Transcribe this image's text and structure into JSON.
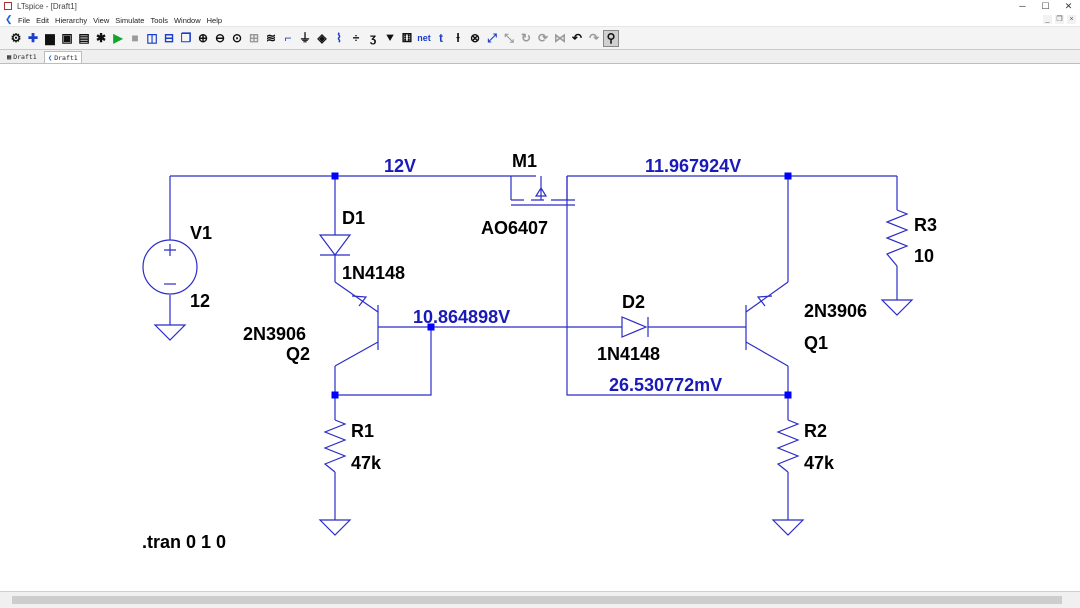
{
  "window": {
    "title": "LTspice - [Draft1]",
    "controls": [
      "─",
      "☐",
      "✕"
    ]
  },
  "menu": {
    "items": [
      "File",
      "Edit",
      "Hierarchy",
      "View",
      "Simulate",
      "Tools",
      "Window",
      "Help"
    ],
    "mdi_controls": [
      "_",
      "❐",
      "×"
    ]
  },
  "toolbar": {
    "icons": [
      {
        "name": "settings-icon",
        "glyph": "⚙",
        "style": ""
      },
      {
        "name": "open-icon",
        "glyph": "✚",
        "style": "blue"
      },
      {
        "name": "open-folder-icon",
        "glyph": "▆",
        "style": ""
      },
      {
        "name": "save-icon",
        "glyph": "▣",
        "style": ""
      },
      {
        "name": "print-icon",
        "glyph": "▤",
        "style": ""
      },
      {
        "name": "chip-icon",
        "glyph": "✱",
        "style": ""
      },
      {
        "name": "run-icon",
        "glyph": "▶",
        "style": "green"
      },
      {
        "name": "halt-icon",
        "glyph": "■",
        "style": "gray"
      },
      {
        "name": "tile-vertical-icon",
        "glyph": "◫",
        "style": "blue"
      },
      {
        "name": "tile-horizontal-icon",
        "glyph": "⊟",
        "style": "blue"
      },
      {
        "name": "cascade-icon",
        "glyph": "❐",
        "style": "blue"
      },
      {
        "name": "zoom-in-icon",
        "glyph": "⊕",
        "style": ""
      },
      {
        "name": "zoom-out-icon",
        "glyph": "⊖",
        "style": ""
      },
      {
        "name": "zoom-fit-icon",
        "glyph": "⊙",
        "style": ""
      },
      {
        "name": "zoom-area-icon",
        "glyph": "⊞",
        "style": "gray"
      },
      {
        "name": "waveform-icon",
        "glyph": "≋",
        "style": ""
      },
      {
        "name": "wire-icon",
        "glyph": "⌐",
        "style": "blue"
      },
      {
        "name": "ground-icon",
        "glyph": "⏚",
        "style": ""
      },
      {
        "name": "label-net-icon",
        "glyph": "◈",
        "style": ""
      },
      {
        "name": "resistor-icon",
        "glyph": "⌇",
        "style": "blue"
      },
      {
        "name": "capacitor-icon",
        "glyph": "÷",
        "style": ""
      },
      {
        "name": "inductor-icon",
        "glyph": "ʒ",
        "style": ""
      },
      {
        "name": "diode-icon",
        "glyph": "⯆",
        "style": ""
      },
      {
        "name": "component-icon",
        "glyph": "⚅",
        "style": ""
      },
      {
        "name": "net-icon",
        "glyph": "net",
        "style": "blue small"
      },
      {
        "name": "text-icon",
        "glyph": "t",
        "style": "blue"
      },
      {
        "name": "spice-directive-icon",
        "glyph": "ƚ",
        "style": ""
      },
      {
        "name": "delete-icon",
        "glyph": "⊗",
        "style": ""
      },
      {
        "name": "move-icon",
        "glyph": "⤢",
        "style": "blue"
      },
      {
        "name": "drag-icon",
        "glyph": "⤡",
        "style": "gray"
      },
      {
        "name": "rotate-icon",
        "glyph": "↻",
        "style": "gray"
      },
      {
        "name": "mirror-icon",
        "glyph": "⟳",
        "style": "gray"
      },
      {
        "name": "flip-icon",
        "glyph": "⋈",
        "style": "gray"
      },
      {
        "name": "undo-icon",
        "glyph": "↶",
        "style": ""
      },
      {
        "name": "redo-icon",
        "glyph": "↷",
        "style": "gray"
      },
      {
        "name": "find-icon",
        "glyph": "⚲",
        "style": "sel"
      }
    ]
  },
  "tabs": [
    {
      "label": "Draft1",
      "active": false
    },
    {
      "label": "Draft1",
      "active": true
    }
  ],
  "schematic": {
    "components": {
      "v1_name": "V1",
      "v1_value": "12",
      "d1_name": "D1",
      "d1_model": "1N4148",
      "d2_name": "D2",
      "d2_model": "1N4148",
      "m1_name": "M1",
      "m1_model": "AO6407",
      "q2_model": "2N3906",
      "q2_name": "Q2",
      "q1_model": "2N3906",
      "q1_name": "Q1",
      "r1_name": "R1",
      "r1_value": "47k",
      "r2_name": "R2",
      "r2_value": "47k",
      "r3_name": "R3",
      "r3_value": "10"
    },
    "net_voltages": {
      "v_12": "12V",
      "v_out": "11.967924V",
      "v_base": "10.864898V",
      "v_sense": "26.530772mV"
    },
    "directive": ".tran 0 1 0",
    "colors": {
      "wire": "#2c2cc8",
      "component": "#2c2cc8",
      "node": "#0000ff",
      "net_label": "#1a1ab8",
      "text": "#000000"
    }
  }
}
